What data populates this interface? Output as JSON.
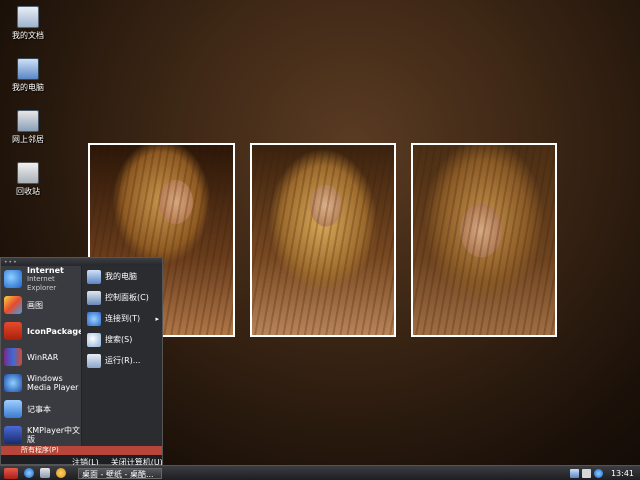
{
  "desktop": {
    "icons": [
      {
        "label": "我的文档",
        "icon": "documents-folder-icon"
      },
      {
        "label": "我的电脑",
        "icon": "computer-icon"
      },
      {
        "label": "网上邻居",
        "icon": "network-places-icon"
      },
      {
        "label": "回收站",
        "icon": "recycle-bin-icon"
      }
    ]
  },
  "start_menu": {
    "pinned": [
      {
        "title": "Internet",
        "subtitle": "Internet Explorer",
        "icon": "internet-explorer-icon"
      },
      {
        "title": "画图",
        "icon": "paint-icon"
      },
      {
        "title": "IconPackager",
        "icon": "iconpackager-icon"
      },
      {
        "title": "WinRAR",
        "icon": "winrar-icon"
      },
      {
        "title": "Windows Media Player",
        "icon": "media-player-icon"
      },
      {
        "title": "记事本",
        "icon": "notepad-icon"
      },
      {
        "title": "KMPlayer中文版",
        "icon": "kmplayer-icon"
      }
    ],
    "places": [
      {
        "label": "我的电脑",
        "icon": "computer-icon"
      },
      {
        "label": "控制面板(C)",
        "icon": "control-panel-icon"
      },
      {
        "label": "连接到(T)",
        "icon": "connect-icon",
        "submenu": "▸"
      },
      {
        "label": "搜索(S)",
        "icon": "search-icon"
      },
      {
        "label": "运行(R)...",
        "icon": "run-icon"
      }
    ],
    "all_programs": "所有程序(P)",
    "logoff": "注销(L)",
    "shutdown": "关闭计算机(U)"
  },
  "taskbar": {
    "task_label": "桌面 - 壁纸 - 桌酷...",
    "clock": "13:41"
  }
}
